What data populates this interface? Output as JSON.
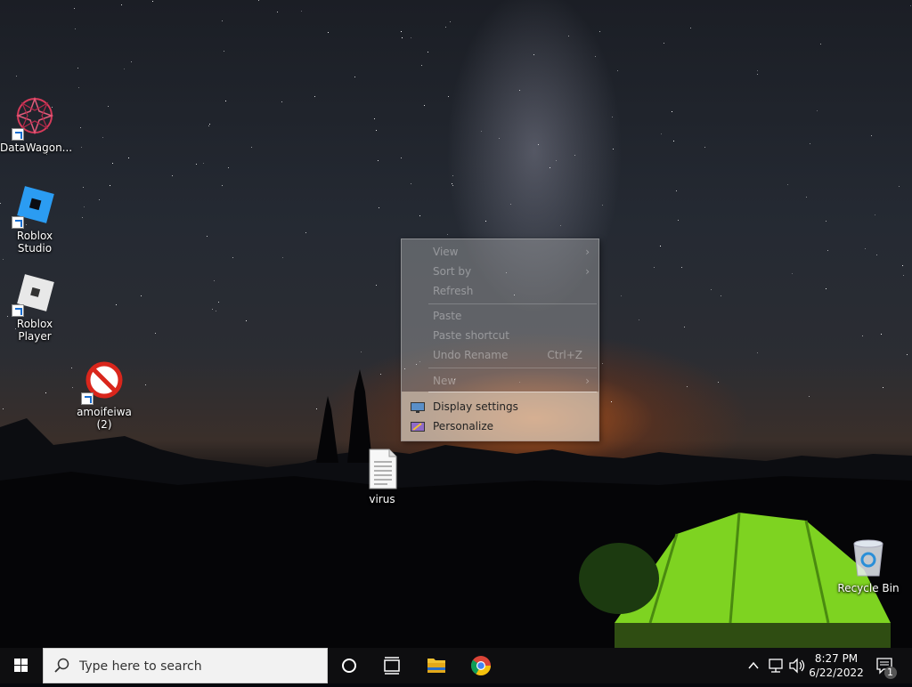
{
  "desktop": {
    "icons": [
      {
        "label": "DataWagon...",
        "icon": "datawagon-logo"
      },
      {
        "label": "Roblox Studio",
        "icon": "roblox-studio-logo"
      },
      {
        "label": "Roblox Player",
        "icon": "roblox-player-logo"
      },
      {
        "label": "amoifeiwa (2)",
        "icon": "prohibited-icon"
      },
      {
        "label": "virus",
        "icon": "text-file-icon"
      },
      {
        "label": "Recycle Bin",
        "icon": "recycle-bin-icon"
      }
    ]
  },
  "context_menu": {
    "items": [
      {
        "label": "View",
        "enabled": false
      },
      {
        "label": "Sort by",
        "enabled": false
      },
      {
        "label": "Refresh",
        "enabled": false
      },
      {
        "label": "Paste",
        "enabled": false
      },
      {
        "label": "Paste shortcut",
        "enabled": false
      },
      {
        "label": "Undo Rename",
        "shortcut": "Ctrl+Z",
        "enabled": false
      },
      {
        "label": "New",
        "enabled": false
      },
      {
        "label": "Display settings",
        "enabled": true,
        "icon": "display-icon"
      },
      {
        "label": "Personalize",
        "enabled": true,
        "icon": "personalize-icon"
      }
    ]
  },
  "taskbar": {
    "search_placeholder": "Type here to search",
    "clock_time": "8:27 PM",
    "clock_date": "6/22/2022",
    "notification_count": "1"
  },
  "colors": {
    "taskbar_bg": "#0e0e10",
    "accent": "#1a6fd1"
  }
}
